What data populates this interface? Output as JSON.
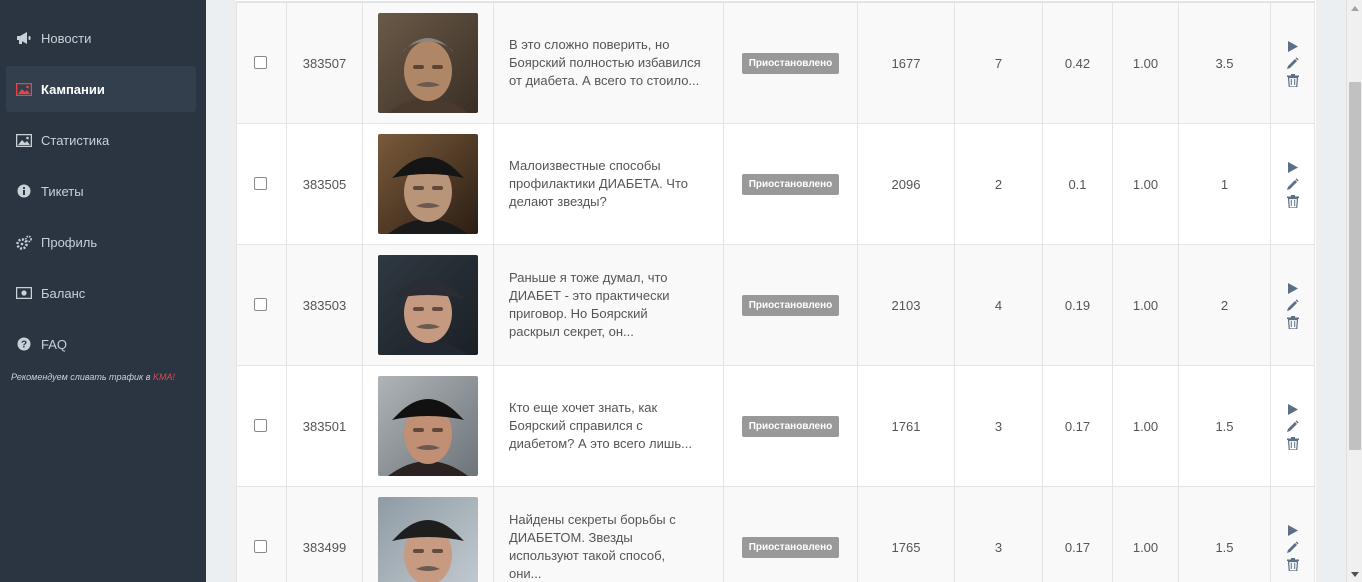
{
  "sidebar": {
    "items": [
      {
        "label": "Новости",
        "icon": "megaphone-icon"
      },
      {
        "label": "Кампании",
        "icon": "image-icon",
        "active": true
      },
      {
        "label": "Статистика",
        "icon": "image-icon"
      },
      {
        "label": "Тикеты",
        "icon": "info-icon"
      },
      {
        "label": "Профиль",
        "icon": "gears-icon"
      },
      {
        "label": "Баланс",
        "icon": "money-icon"
      },
      {
        "label": "FAQ",
        "icon": "question-icon"
      }
    ],
    "promo_prefix": "Рекомендуем сливать трафик в ",
    "promo_brand": "KMA!"
  },
  "colors": {
    "sidebar_bg": "#2b3542",
    "active_item_bg": "#343f4d",
    "active_icon": "#e04848",
    "status_badge": "#999999",
    "action_icons": "#5b6f86"
  },
  "rows": [
    {
      "id": "383507",
      "text": "В это сложно поверить, но Боярский полностью избавился от диабета. А всего то стоило...",
      "status": "Приостановлено",
      "v1": "1677",
      "v2": "7",
      "v3": "0.42",
      "v4": "1.00",
      "v5": "3.5"
    },
    {
      "id": "383505",
      "text": "Малоизвестные способы профилактики ДИАБЕТА. Что делают звезды?",
      "status": "Приостановлено",
      "v1": "2096",
      "v2": "2",
      "v3": "0.1",
      "v4": "1.00",
      "v5": "1"
    },
    {
      "id": "383503",
      "text": "Раньше я тоже думал, что ДИАБЕТ - это практически приговор. Но Боярский раскрыл секрет, он...",
      "status": "Приостановлено",
      "v1": "2103",
      "v2": "4",
      "v3": "0.19",
      "v4": "1.00",
      "v5": "2"
    },
    {
      "id": "383501",
      "text": "Кто еще хочет знать, как Боярский справился с диабетом? А это всего лишь...",
      "status": "Приостановлено",
      "v1": "1761",
      "v2": "3",
      "v3": "0.17",
      "v4": "1.00",
      "v5": "1.5"
    },
    {
      "id": "383499",
      "text": "Найдены секреты борьбы с ДИАБЕТОМ. Звезды используют такой способ, они...",
      "status": "Приостановлено",
      "v1": "1765",
      "v2": "3",
      "v3": "0.17",
      "v4": "1.00",
      "v5": "1.5"
    }
  ],
  "row_actions": [
    "play-icon",
    "edit-icon",
    "trash-icon"
  ]
}
